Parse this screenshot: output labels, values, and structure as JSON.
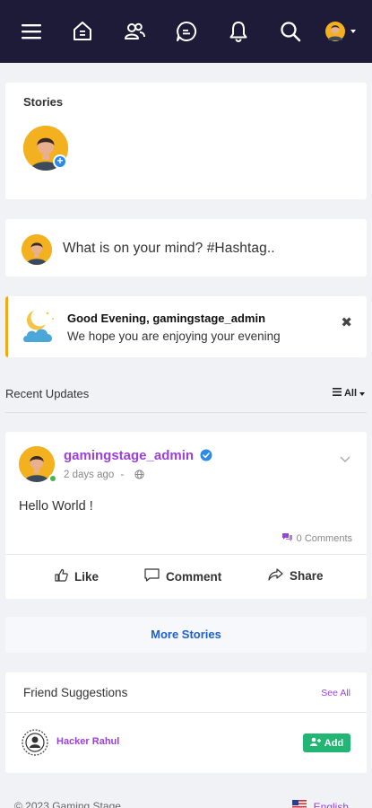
{
  "nav": {
    "icons": [
      "menu-icon",
      "home-icon",
      "friends-icon",
      "messages-icon",
      "notifications-icon",
      "search-icon",
      "profile-menu-icon"
    ],
    "background": "#1e1b38"
  },
  "stories": {
    "title": "Stories"
  },
  "composer": {
    "placeholder": "What is on your mind? #Hashtag.."
  },
  "greeting": {
    "title": "Good Evening, gamingstage_admin",
    "subtitle": "We hope you are enjoying your evening"
  },
  "recent_updates": {
    "title": "Recent Updates",
    "filter_label": "All"
  },
  "post": {
    "author": "gamingstage_admin",
    "time": "2 days ago",
    "separator": "-",
    "body": "Hello World !",
    "comments": "0 Comments",
    "actions": {
      "like": "Like",
      "comment": "Comment",
      "share": "Share"
    }
  },
  "more_stories": "More Stories",
  "friend_suggestions": {
    "title": "Friend Suggestions",
    "see_all": "See All",
    "items": [
      {
        "name": "Hacker Rahul",
        "add_label": "Add"
      }
    ]
  },
  "footer": {
    "copyright": "© 2023 Gaming Stage",
    "language": "English"
  },
  "colors": {
    "accent_purple": "#9b41d8",
    "link_blue": "#1d5fd1",
    "add_green": "#22b573",
    "greeting_border": "#f3a917",
    "avatar_bg": "#f3b120"
  }
}
